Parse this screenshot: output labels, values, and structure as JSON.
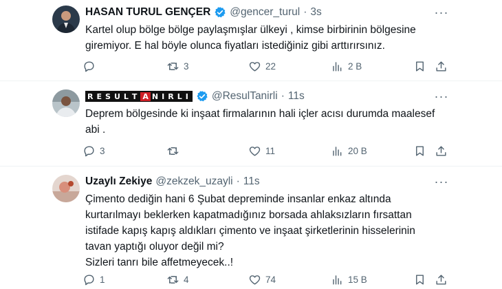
{
  "tweets": [
    {
      "name": "HASAN TURUL GENÇER",
      "handle": "@gencer_turul",
      "dot": "·",
      "time": "3s",
      "text": "Kartel olup bölge bölge paylaşmışlar ülkeyi , kimse birbirinin bölgesine\ngiremiyor. E hal böyle olunca fiyatları istediğiniz gibi arttırırsınız.",
      "replies": "",
      "retweets": "3",
      "likes": "22",
      "views": "2 B"
    },
    {
      "name_parts": [
        "R",
        "E",
        "S",
        "U",
        "L",
        "T",
        "A",
        "N",
        "I",
        "R",
        "L",
        "I"
      ],
      "handle": "@ResulTanirli",
      "dot": "·",
      "time": "11s",
      "text": "Deprem bölgesinde ki inşaat firmalarının hali içler acısı durumda maalesef\nabi .",
      "replies": "3",
      "retweets": "",
      "likes": "11",
      "views": "20 B"
    },
    {
      "name": "Uzaylı Zekiye",
      "handle": "@zekzek_uzayli",
      "dot": "·",
      "time": "11s",
      "text": "Çimento dediğin hani 6 Şubat depreminde insanlar enkaz altında\nkurtarılmayı beklerken kapatmadığınız borsada ahlaksızların fırsattan\nistifade kapış kapış aldıkları çimento ve inşaat şirketlerinin hisselerinin\ntavan yaptığı oluyor değil mi?\nSizleri tanrı bile affetmeyecek..!",
      "replies": "1",
      "retweets": "4",
      "likes": "74",
      "views": "15 B"
    }
  ],
  "colors": {
    "verified": "#1d9bf0",
    "text": "#0f1419",
    "muted": "#536471",
    "brand_red": "#d01f26"
  },
  "icons": [
    "reply-icon",
    "retweet-icon",
    "like-icon",
    "views-icon",
    "bookmark-icon",
    "share-icon",
    "verified-icon",
    "more-icon"
  ]
}
